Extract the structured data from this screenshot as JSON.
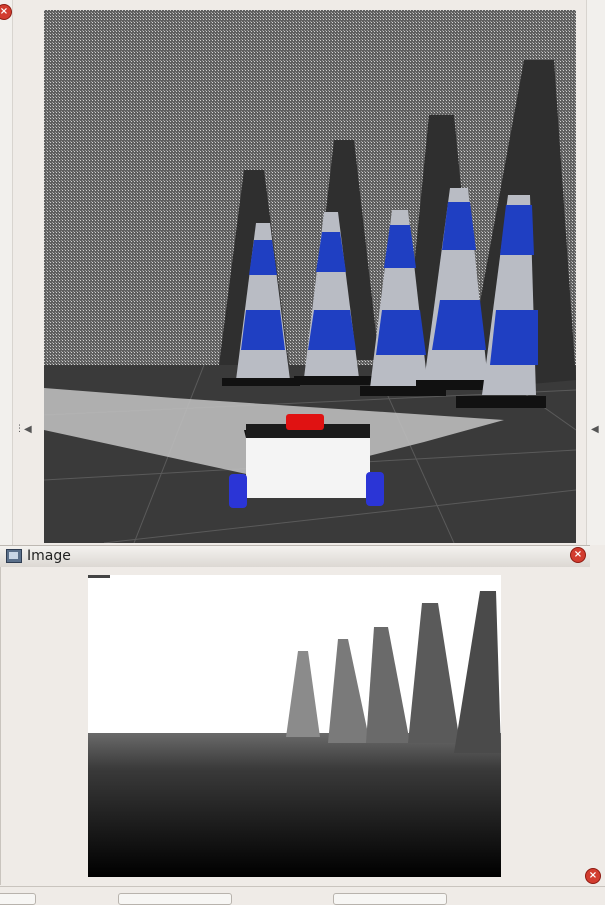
{
  "viewport3d": {
    "name": "3D view",
    "ground_color": "#3a3a3a",
    "wall_color": "#8a8a8a",
    "cone_stripe_color": "#1f3fc2",
    "cone_light_color": "#b9bcc4",
    "robot_body_color": "#f4f4f4",
    "robot_sensor_color": "#e01212",
    "robot_wheel_color": "#2b35d6"
  },
  "image_window": {
    "title": "Image",
    "icon": "image-window-icon",
    "close_icon": "close-icon",
    "overlay_label": "Ras"
  },
  "depth_image": {
    "far_color": "#ffffff",
    "near_color": "#000000"
  }
}
